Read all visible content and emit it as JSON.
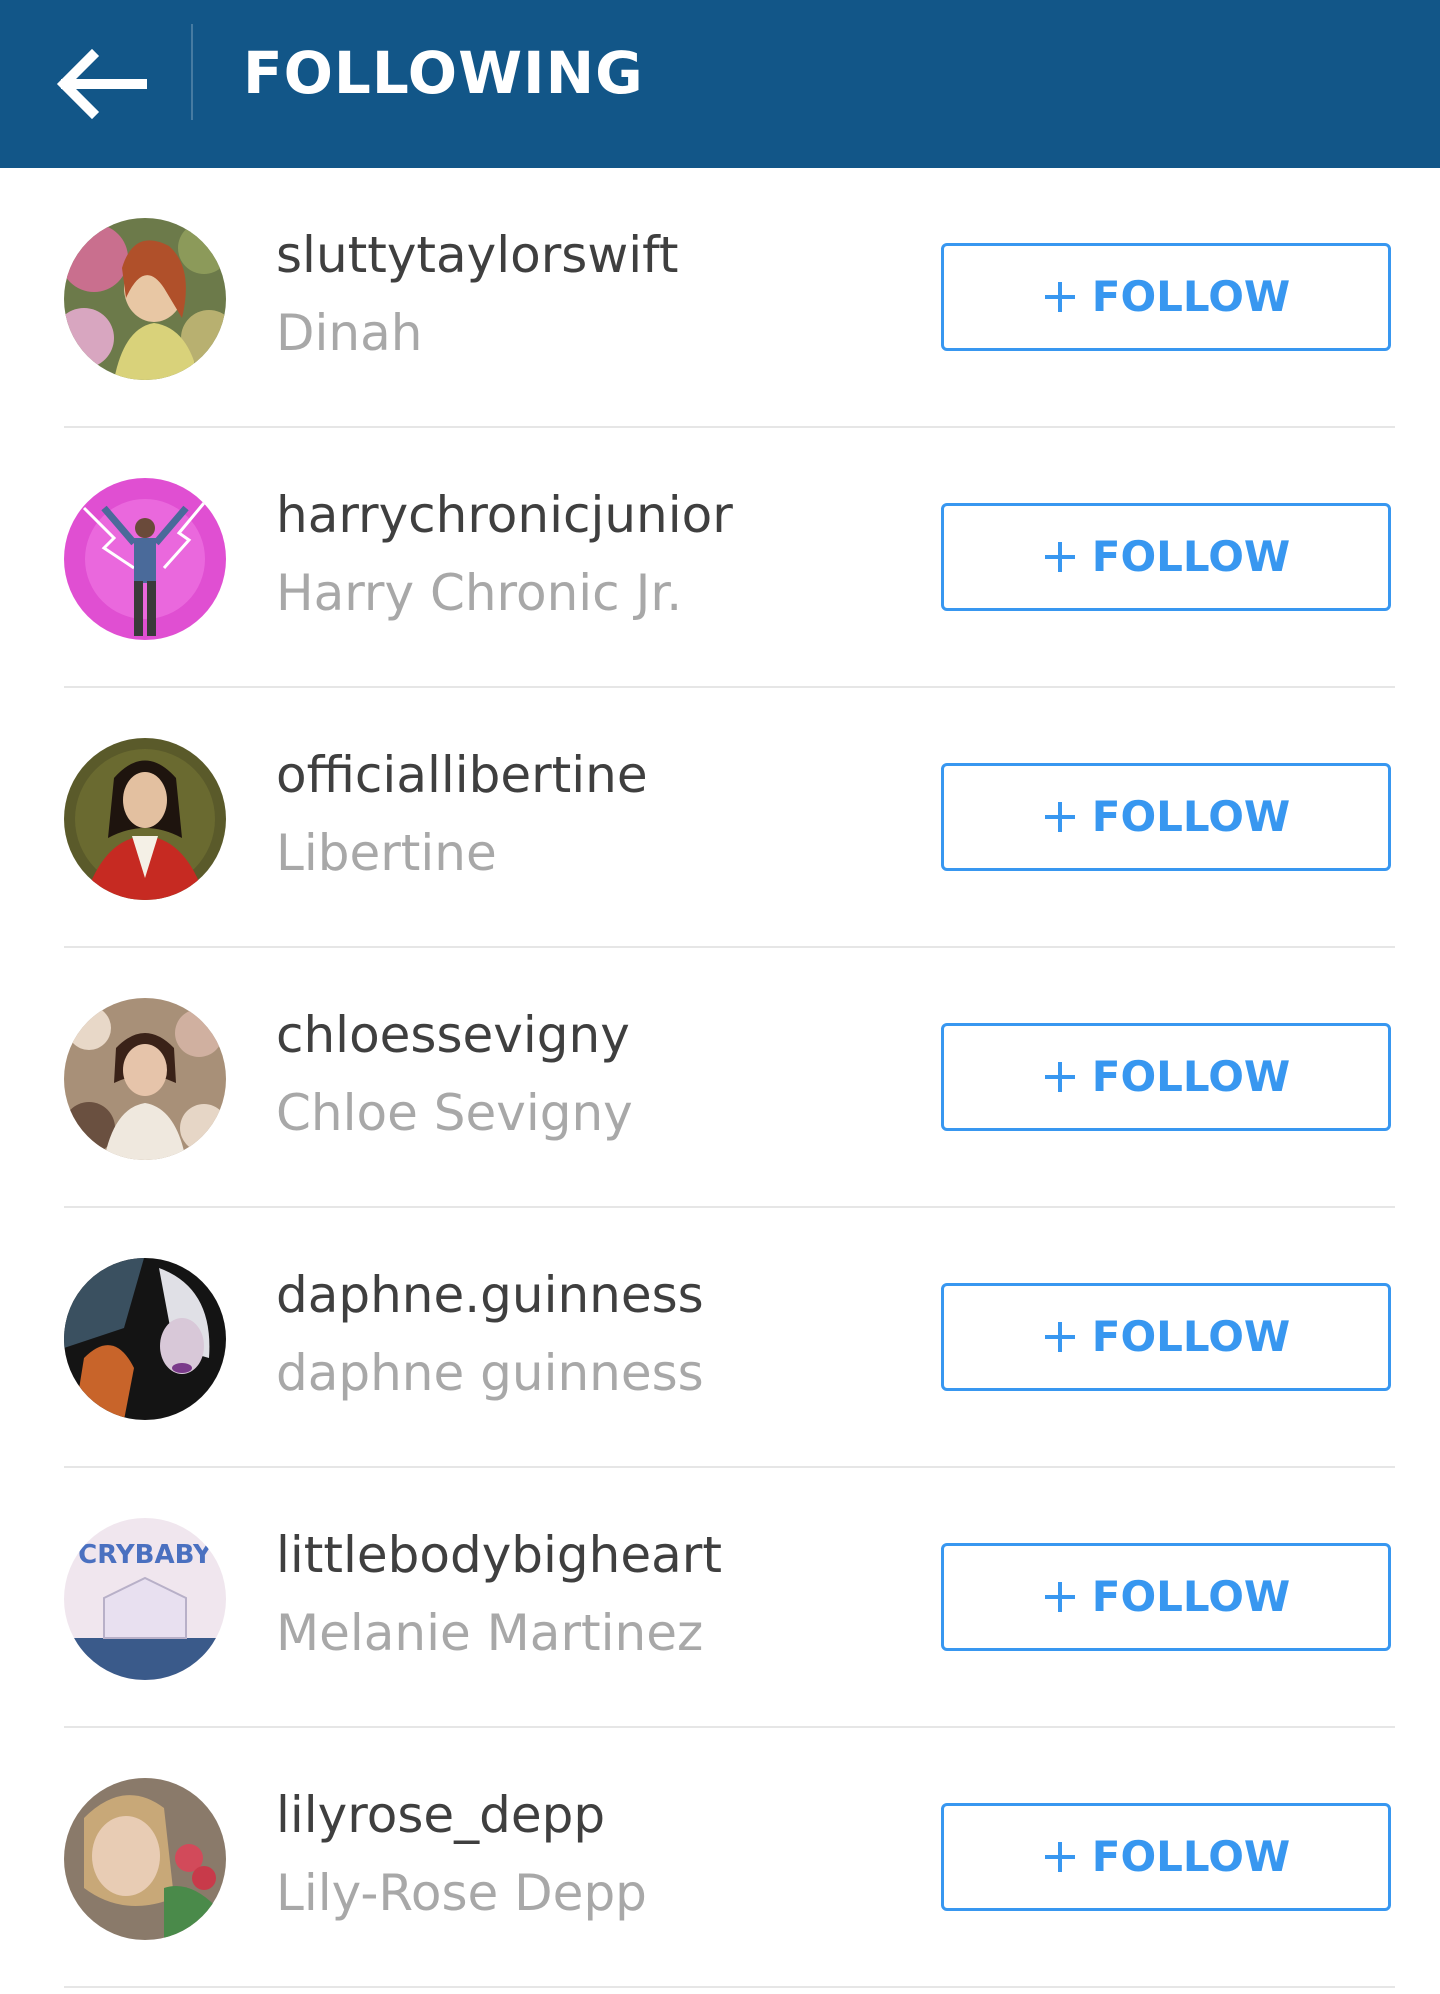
{
  "header": {
    "title": "FOLLOWING",
    "back_icon": "back-arrow-icon",
    "background_color": "#125688"
  },
  "follow_button": {
    "label": "FOLLOW",
    "icon": "plus-icon",
    "accent_color": "#3897f0"
  },
  "users": [
    {
      "username": "sluttytaylorswift",
      "full_name": "Dinah",
      "avatar": "avatar-painting-woman-flowers"
    },
    {
      "username": "harrychronicjunior",
      "full_name": "Harry Chronic Jr.",
      "avatar": "avatar-man-pink-lightning"
    },
    {
      "username": "officiallibertine",
      "full_name": "Libertine",
      "avatar": "avatar-portrait-red-coat"
    },
    {
      "username": "chloessevigny",
      "full_name": "Chloe Sevigny",
      "avatar": "avatar-girl-floral"
    },
    {
      "username": "daphne.guinness",
      "full_name": "daphne guinness",
      "avatar": "avatar-dark-portrait"
    },
    {
      "username": "littlebodybigheart",
      "full_name": "Melanie Martinez",
      "avatar": "avatar-crybaby"
    },
    {
      "username": "lilyrose_depp",
      "full_name": "Lily-Rose Depp",
      "avatar": "avatar-girl-roses"
    }
  ],
  "avatar_texts": {
    "crybaby": "CRYBABY"
  }
}
